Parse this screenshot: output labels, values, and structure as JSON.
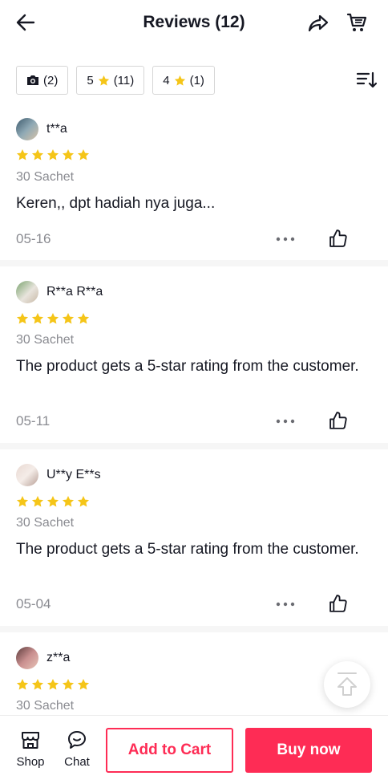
{
  "header": {
    "title": "Reviews (12)",
    "icons": [
      "back-arrow-icon",
      "share-icon",
      "cart-icon"
    ]
  },
  "filters": [
    {
      "icon": "camera-icon",
      "label": "(2)"
    },
    {
      "prefix": "5",
      "icon": "star-icon",
      "label": "(11)"
    },
    {
      "prefix": "4",
      "icon": "star-icon",
      "label": "(1)"
    }
  ],
  "colors": {
    "star": "#F5C518",
    "accent": "#FE2C55",
    "muted": "#8A8B91"
  },
  "reviews": [
    {
      "user": "t**a",
      "rating": 5,
      "variant": "30 Sachet",
      "text": "Keren,, dpt hadiah nya juga...",
      "date": "05-16"
    },
    {
      "user": "R**a R**a",
      "rating": 5,
      "variant": "30 Sachet",
      "text": "The product gets a 5-star rating from the customer.",
      "date": "05-11"
    },
    {
      "user": "U**y E**s",
      "rating": 5,
      "variant": "30 Sachet",
      "text": "The product gets a 5-star rating from the customer.",
      "date": "05-04"
    },
    {
      "user": "z**a",
      "rating": 5,
      "variant": "30 Sachet"
    }
  ],
  "bottom_bar": {
    "shop_label": "Shop",
    "chat_label": "Chat",
    "add_to_cart_label": "Add to Cart",
    "buy_now_label": "Buy now"
  }
}
